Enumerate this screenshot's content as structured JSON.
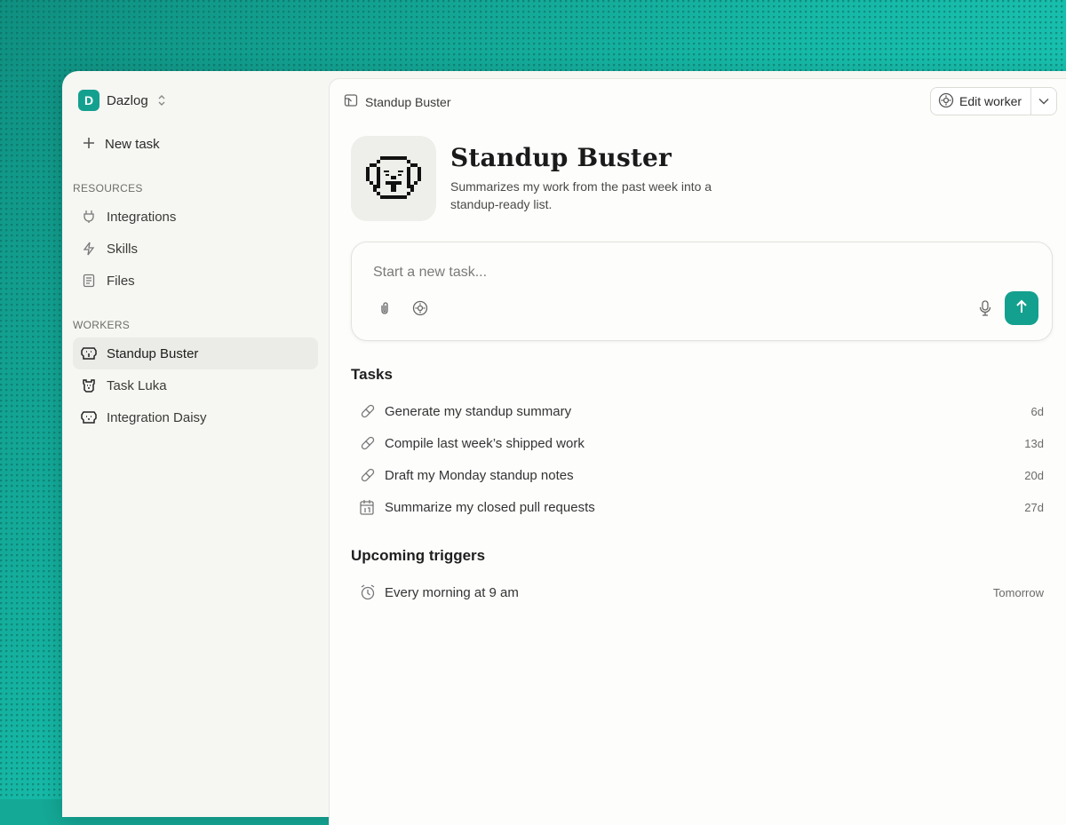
{
  "workspace": {
    "initial": "D",
    "name": "Dazlog"
  },
  "sidebar": {
    "new_task": "New task",
    "resources_label": "RESOURCES",
    "resources": [
      {
        "label": "Integrations",
        "icon": "plug-icon"
      },
      {
        "label": "Skills",
        "icon": "lightning-icon"
      },
      {
        "label": "Files",
        "icon": "document-icon"
      }
    ],
    "workers_label": "WORKERS",
    "workers": [
      {
        "label": "Standup Buster",
        "icon": "dog-icon",
        "active": true
      },
      {
        "label": "Task Luka",
        "icon": "bear-icon",
        "active": false
      },
      {
        "label": "Integration Daisy",
        "icon": "dog-icon",
        "active": false
      }
    ]
  },
  "header": {
    "title": "Standup Buster",
    "edit_label": "Edit worker"
  },
  "worker": {
    "name": "Standup Buster",
    "description": "Summarizes my work from the past week into a standup-ready list."
  },
  "composer": {
    "placeholder": "Start a new task..."
  },
  "tasks": {
    "heading": "Tasks",
    "items": [
      {
        "title": "Generate my standup summary",
        "age": "6d",
        "icon": "pill-icon"
      },
      {
        "title": "Compile last week’s shipped work",
        "age": "13d",
        "icon": "pill-icon"
      },
      {
        "title": "Draft my Monday standup notes",
        "age": "20d",
        "icon": "pill-icon"
      },
      {
        "title": "Summarize my closed pull requests",
        "age": "27d",
        "icon": "calendar-icon"
      }
    ]
  },
  "triggers": {
    "heading": "Upcoming triggers",
    "items": [
      {
        "title": "Every morning at 9 am",
        "when": "Tomorrow",
        "icon": "alarm-clock-icon"
      }
    ]
  },
  "colors": {
    "accent": "#14a08e",
    "background": "#14a896"
  }
}
